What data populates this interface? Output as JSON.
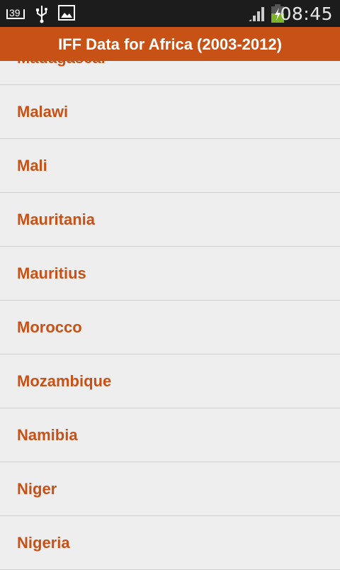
{
  "status_bar": {
    "notification_count": "39",
    "icons": [
      "notification-badge-icon",
      "usb-icon",
      "image-icon",
      "signal-icon",
      "battery-charging-icon"
    ],
    "time": "08:45"
  },
  "app_bar": {
    "title": "IFF Data for Africa (2003-2012)"
  },
  "colors": {
    "accent": "#c85116",
    "background": "#eeeeee",
    "divider": "#d0d0d0",
    "status_bar": "#1c1c1c"
  },
  "countries": [
    {
      "label": "Madagascar"
    },
    {
      "label": "Malawi"
    },
    {
      "label": "Mali"
    },
    {
      "label": "Mauritania"
    },
    {
      "label": "Mauritius"
    },
    {
      "label": "Morocco"
    },
    {
      "label": "Mozambique"
    },
    {
      "label": "Namibia"
    },
    {
      "label": "Niger"
    },
    {
      "label": "Nigeria"
    }
  ]
}
